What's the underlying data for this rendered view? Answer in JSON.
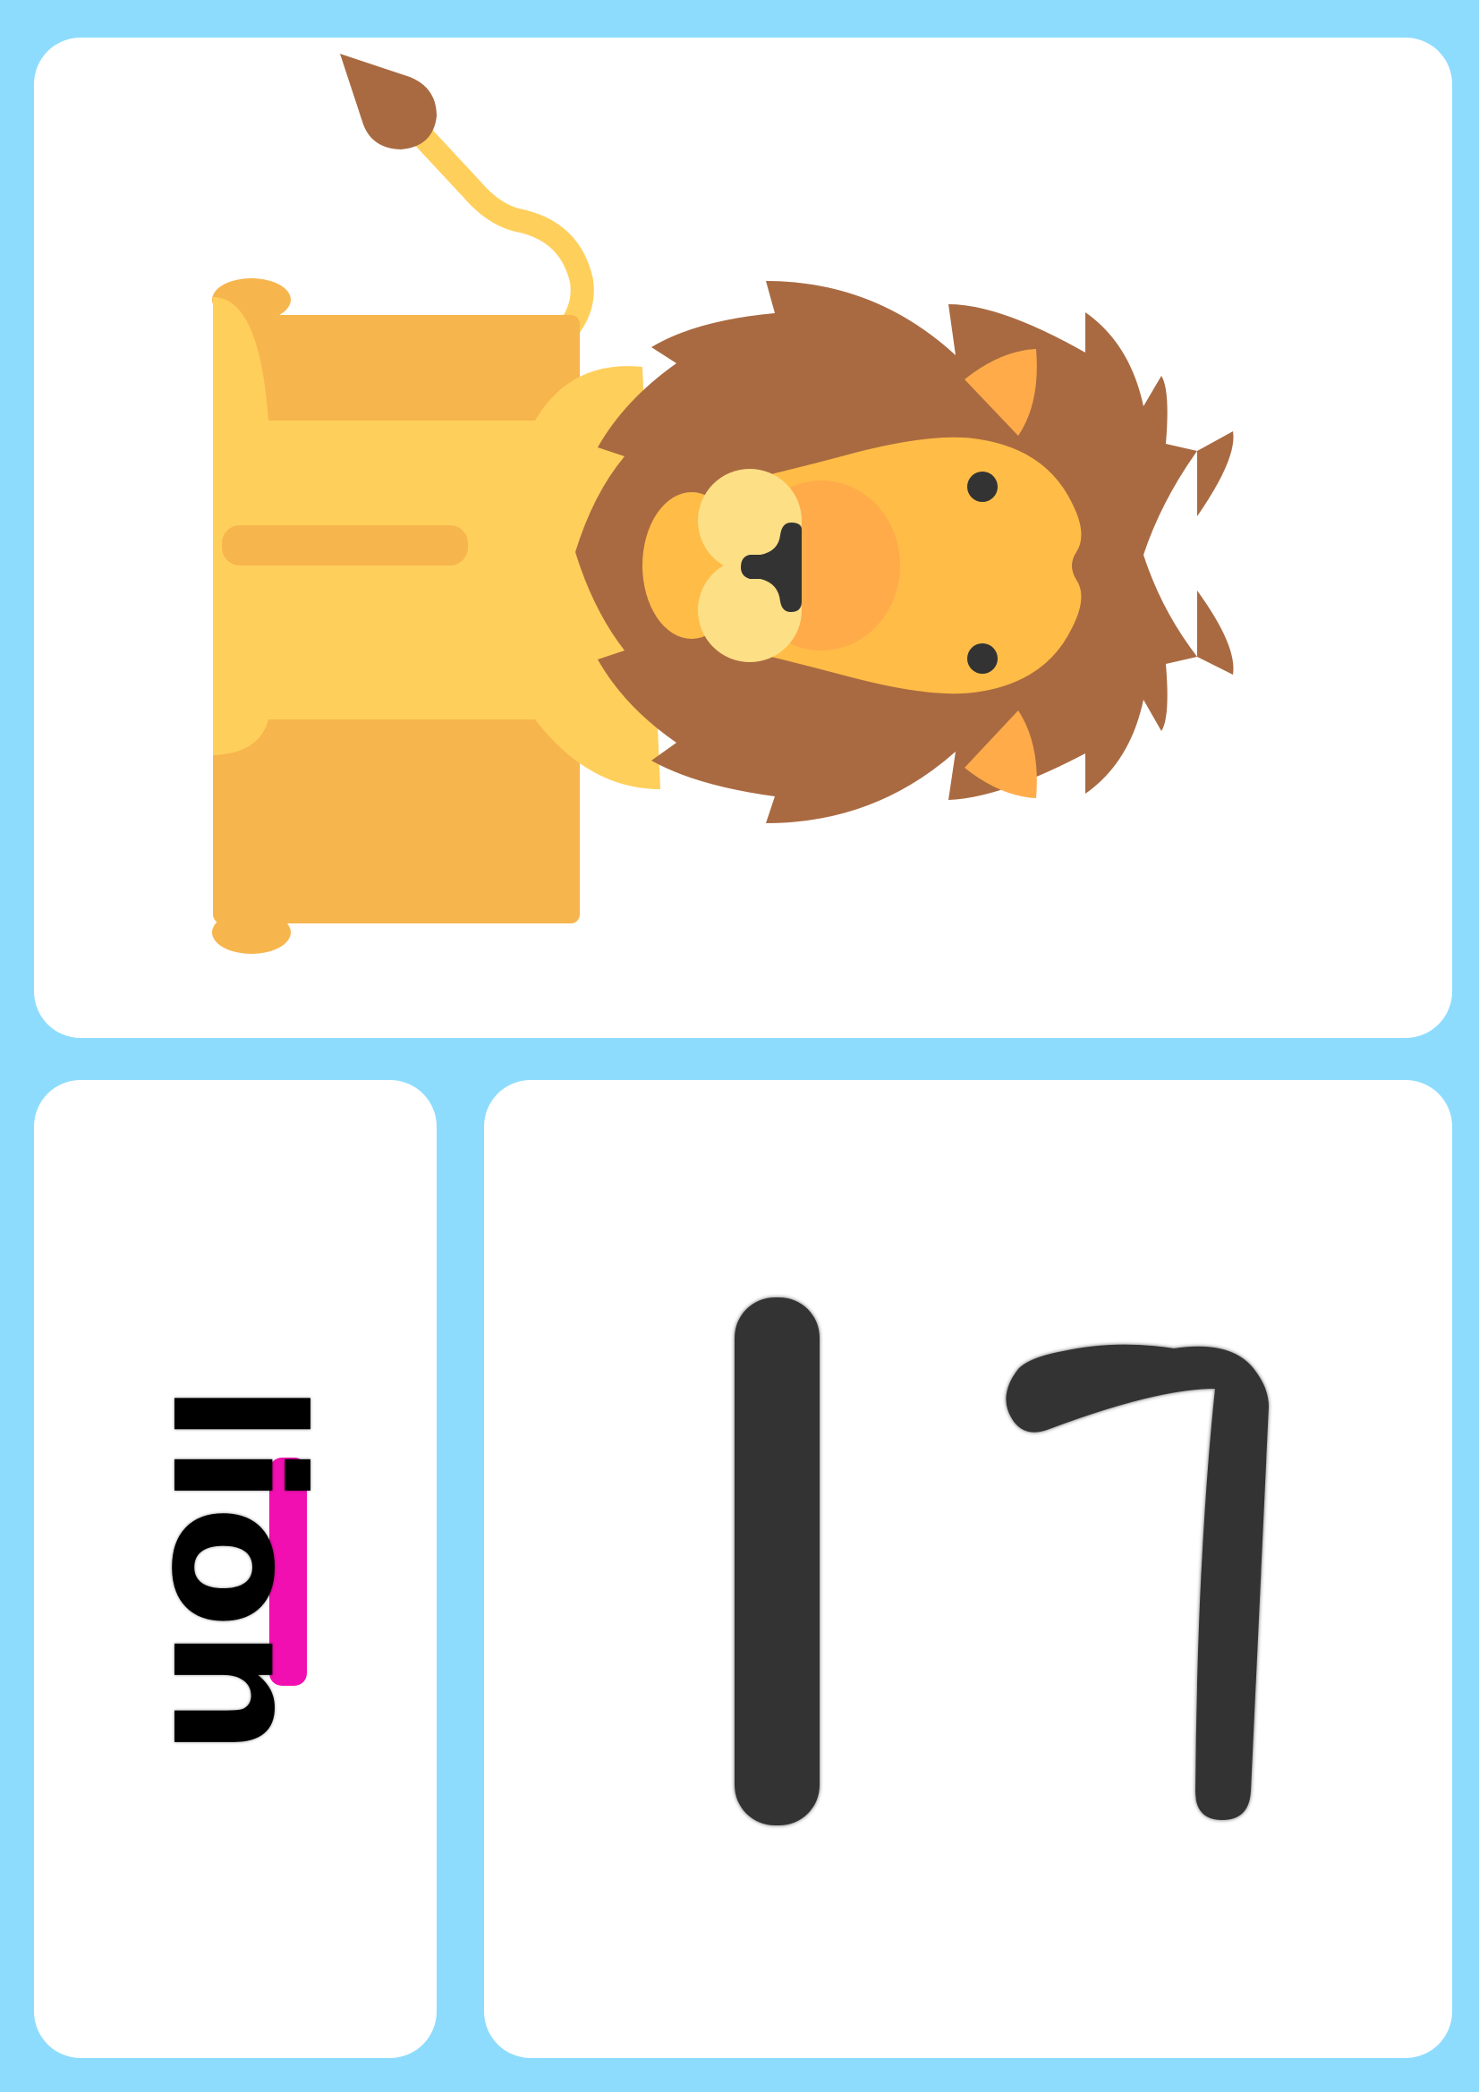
{
  "card": {
    "word": "lion",
    "letter": "L",
    "highlight_color": "#f20fb1",
    "background_color": "#8edcfd",
    "panel_color": "#ffffff",
    "illustration": "lion-illustration",
    "lion_colors": {
      "mane": "#a96a41",
      "body": "#ffcf5c",
      "body_shade": "#f7b54d",
      "face": "#ffbc47",
      "muzzle": "#fddf86",
      "cheek": "#ffab4a",
      "eyes": "#333333"
    }
  }
}
